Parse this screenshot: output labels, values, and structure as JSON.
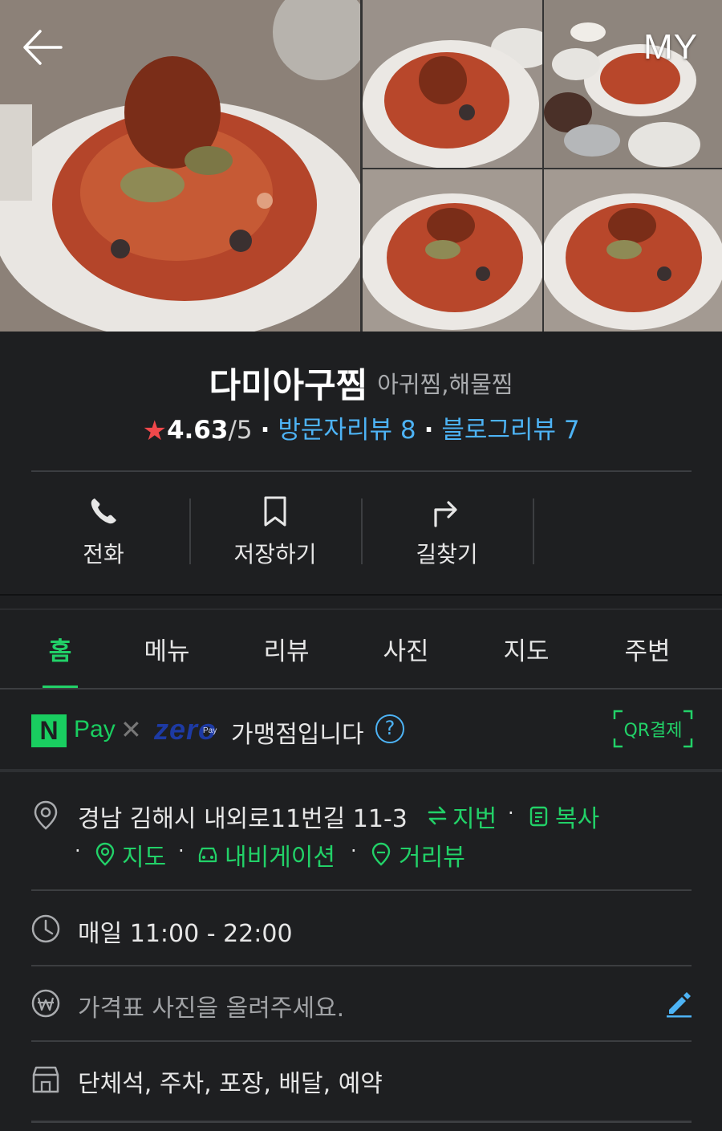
{
  "header": {
    "my_label": "MY"
  },
  "place": {
    "name": "다미아구찜",
    "category": "아귀찜,해물찜",
    "rating_star": "★",
    "rating_score": "4.63",
    "rating_out_of": "/5",
    "visitor_reviews": "방문자리뷰 8",
    "blog_reviews": "블로그리뷰 7",
    "separator": "·"
  },
  "actions": [
    {
      "label": "전화",
      "icon": "phone-icon"
    },
    {
      "label": "저장하기",
      "icon": "bookmark-icon"
    },
    {
      "label": "길찾기",
      "icon": "directions-icon"
    }
  ],
  "tabs": [
    "홈",
    "메뉴",
    "리뷰",
    "사진",
    "지도",
    "주변"
  ],
  "active_tab": "홈",
  "pay": {
    "npay_mark": "N",
    "npay_word": "Pay",
    "times": "✕",
    "zero_word": "zero",
    "zero_sub": "Pay",
    "text": "가맹점입니다",
    "help": "?",
    "qr_label": "QR결제"
  },
  "info": {
    "address": "경남 김해시 내외로11번길 11-3",
    "lot_number_link": "지번",
    "copy_link": "복사",
    "map_link": "지도",
    "navigation_link": "내비게이션",
    "street_view_link": "거리뷰",
    "hours": "매일 11:00 - 22:00",
    "price_prompt": "가격표 사진을 올려주세요.",
    "facilities": "단체석, 주차, 포장, 배달, 예약"
  },
  "colors": {
    "background": "#1e1f21",
    "accent_green": "#22d168",
    "link_blue": "#4db3f5",
    "star_red": "#f0484b"
  }
}
